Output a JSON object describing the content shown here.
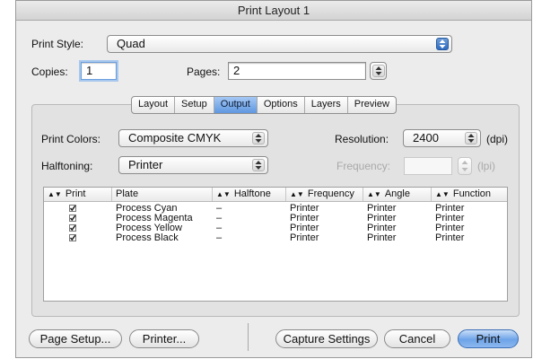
{
  "window": {
    "title": "Print Layout 1"
  },
  "print_style": {
    "label": "Print Style:",
    "value": "Quad"
  },
  "copies": {
    "label": "Copies:",
    "value": "1"
  },
  "pages": {
    "label": "Pages:",
    "value": "2"
  },
  "tabs": [
    {
      "label": "Layout",
      "selected": false
    },
    {
      "label": "Setup",
      "selected": false
    },
    {
      "label": "Output",
      "selected": true
    },
    {
      "label": "Options",
      "selected": false
    },
    {
      "label": "Layers",
      "selected": false
    },
    {
      "label": "Preview",
      "selected": false
    }
  ],
  "output": {
    "print_colors": {
      "label": "Print Colors:",
      "value": "Composite CMYK"
    },
    "halftoning": {
      "label": "Halftoning:",
      "value": "Printer"
    },
    "resolution": {
      "label": "Resolution:",
      "value": "2400",
      "unit": "(dpi)"
    },
    "frequency": {
      "label": "Frequency:",
      "value": "",
      "unit": "(lpi)",
      "enabled": false
    }
  },
  "table": {
    "columns": [
      "Print",
      "Plate",
      "Halftone",
      "Frequency",
      "Angle",
      "Function"
    ],
    "rows": [
      {
        "print": true,
        "plate": "Process Cyan",
        "halftone": "–",
        "frequency": "Printer",
        "angle": "Printer",
        "function": "Printer"
      },
      {
        "print": true,
        "plate": "Process Magenta",
        "halftone": "–",
        "frequency": "Printer",
        "angle": "Printer",
        "function": "Printer"
      },
      {
        "print": true,
        "plate": "Process Yellow",
        "halftone": "–",
        "frequency": "Printer",
        "angle": "Printer",
        "function": "Printer"
      },
      {
        "print": true,
        "plate": "Process Black",
        "halftone": "–",
        "frequency": "Printer",
        "angle": "Printer",
        "function": "Printer"
      }
    ]
  },
  "buttons": {
    "page_setup": "Page Setup...",
    "printer": "Printer...",
    "capture_settings": "Capture Settings",
    "cancel": "Cancel",
    "print": "Print"
  },
  "colors": {
    "accent": "#5f97e0",
    "default_button": "#6ea3e8",
    "window_bg": "#ececec"
  }
}
